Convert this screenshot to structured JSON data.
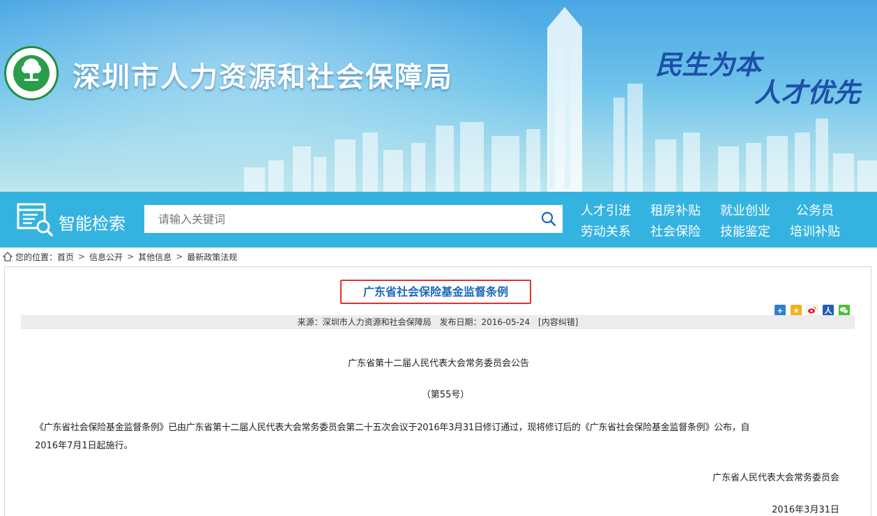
{
  "header": {
    "site_title": "深圳市人力资源和社会保障局",
    "slogan_line1": "民生为本",
    "slogan_line2": "人才优先",
    "logo_icon": "tree-emblem-icon"
  },
  "search": {
    "label": "智能检索",
    "placeholder": "请输入关键词",
    "icon": "search-icon"
  },
  "quick_links": [
    "人才引进",
    "租房补贴",
    "就业创业",
    "公务员",
    "劳动关系",
    "社会保险",
    "技能鉴定",
    "培训补贴"
  ],
  "breadcrumb": {
    "prefix": "您的位置：",
    "items": [
      "首页",
      "信息公开",
      "其他信息",
      "最新政策法规"
    ],
    "separator": ">"
  },
  "article": {
    "title": "广东省社会保险基金监督条例",
    "source_label": "来源：深圳市人力资源和社会保障局",
    "date_label": "发布日期：2016-05-24",
    "error_link": "[内容纠错]",
    "heading": "广东省第十二届人民代表大会常务委员会公告",
    "number": "（第55号）",
    "body_line1": "《广东省社会保险基金监督条例》已由广东省第十二届人民代表大会常务委员会第二十五次会议于2016年3月31日修订通过，现将修订后的《广东省社会保险基金监督条例》公布，自",
    "body_line2": "2016年7月1日起施行。",
    "signature": "广东省人民代表大会常务委员会",
    "sign_date": "2016年3月31日"
  },
  "share_icons": [
    "share-plus-icon",
    "qzone-icon",
    "weibo-icon",
    "renren-icon",
    "wechat-icon"
  ],
  "colors": {
    "searchbar_bg": "#34b3e0",
    "title_color": "#1a67b8",
    "highlight_border": "#e23030",
    "slogan_color": "#1d4fa8"
  }
}
